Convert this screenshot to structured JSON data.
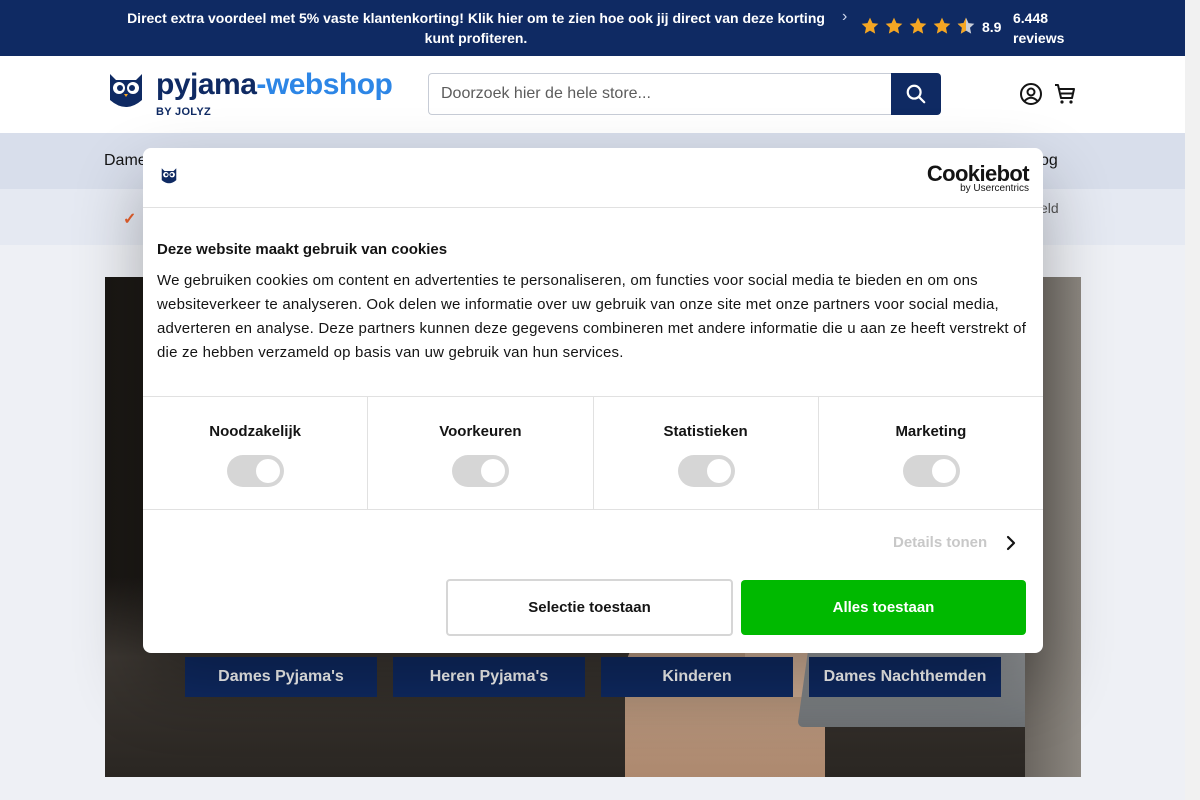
{
  "topbar": {
    "promo": "Direct extra voordeel met 5% vaste klantenkorting! Klik hier om te zien hoe ook jij direct van deze korting kunt profiteren.",
    "score": "8.9",
    "reviews": "6.448 reviews",
    "rating_stars": 4.5,
    "star_color": "#f5a623"
  },
  "header": {
    "logo_text_main": "pyjama",
    "logo_text_accent": "-webshop",
    "logo_byline": "BY JOLYZ",
    "search_placeholder": "Doorzoek hier de hele store..."
  },
  "nav": {
    "first_item": "Dame",
    "last_item": "og"
  },
  "usp": {
    "right_text": "eld"
  },
  "hero": {
    "categories": [
      "Dames Pyjama's",
      "Heren Pyjama's",
      "Kinderen",
      "Dames Nachthemden"
    ]
  },
  "cookie_dialog": {
    "brand": "Cookiebot",
    "brand_by": "by Usercentrics",
    "title": "Deze website maakt gebruik van cookies",
    "text": "We gebruiken cookies om content en advertenties te personaliseren, om functies voor social media te bieden en om ons websiteverkeer te analyseren. Ook delen we informatie over uw gebruik van onze site met onze partners voor social media, adverteren en analyse. Deze partners kunnen deze gegevens combineren met andere informatie die u aan ze heeft verstrekt of die ze hebben verzameld op basis van uw gebruik van hun services.",
    "categories": [
      {
        "label": "Noodzakelijk"
      },
      {
        "label": "Voorkeuren"
      },
      {
        "label": "Statistieken"
      },
      {
        "label": "Marketing"
      }
    ],
    "details_label": "Details tonen",
    "select_button": "Selectie toestaan",
    "allow_all_button": "Alles toestaan",
    "accent_color": "#00b900"
  }
}
